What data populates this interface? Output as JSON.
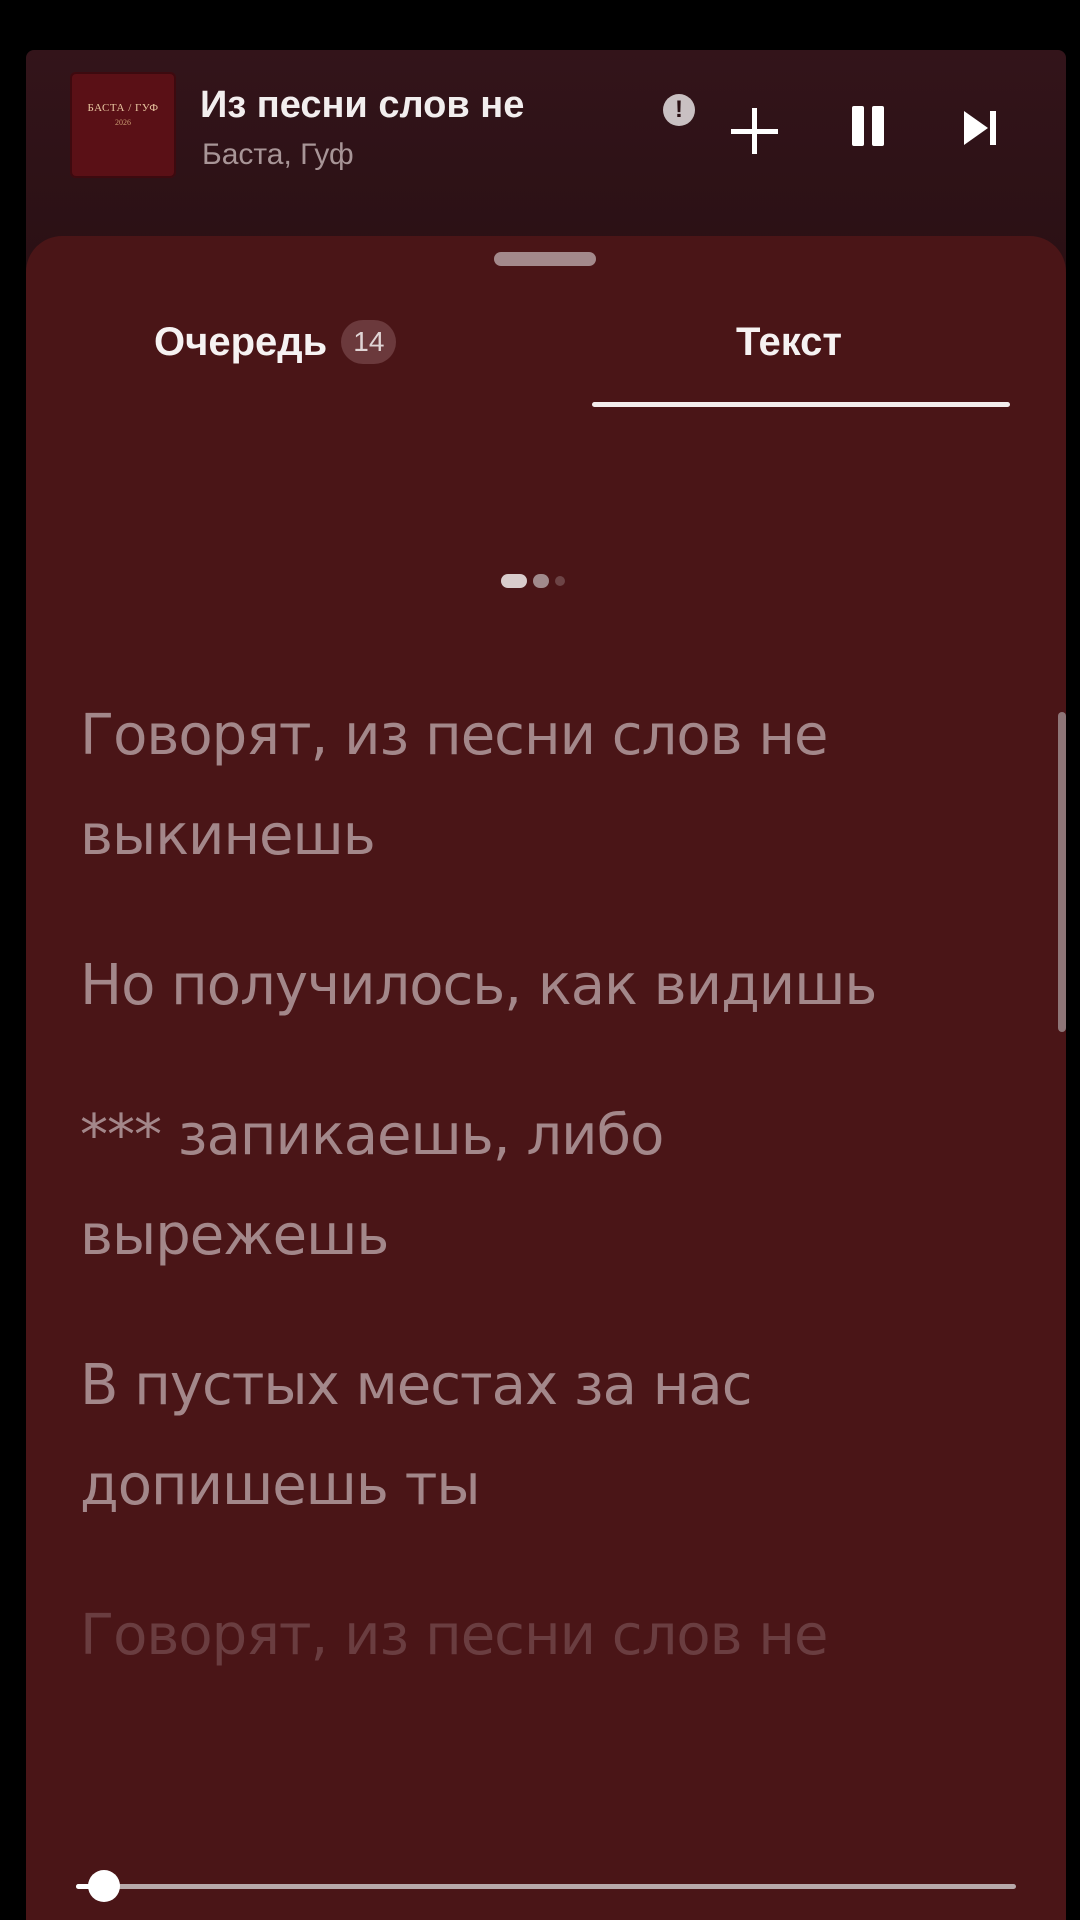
{
  "player": {
    "cover_text": "БАСТА / ГУФ",
    "cover_sub": "2026",
    "title": "Из песни слов не",
    "artist": "Баста, Гуф",
    "explicit_badge": "!",
    "icons": [
      "plus-icon",
      "pause-icon",
      "next-icon"
    ]
  },
  "tabs": {
    "queue_label": "Очередь",
    "queue_count": "14",
    "lyrics_label": "Текст",
    "active": "lyrics"
  },
  "lyrics": [
    "Говорят, из песни слов не выкинешь",
    "Но получилось, как видишь",
    "*** запикаешь, либо вырежешь",
    "В пустых местах за нас допишешь ты",
    "Говорят, из песни слов не"
  ],
  "progress": {
    "fraction": 0.03
  },
  "colors": {
    "background": "#4a1517",
    "header": "#2a1014",
    "lyric_text": "#a3878a",
    "accent": "#ffffff"
  }
}
